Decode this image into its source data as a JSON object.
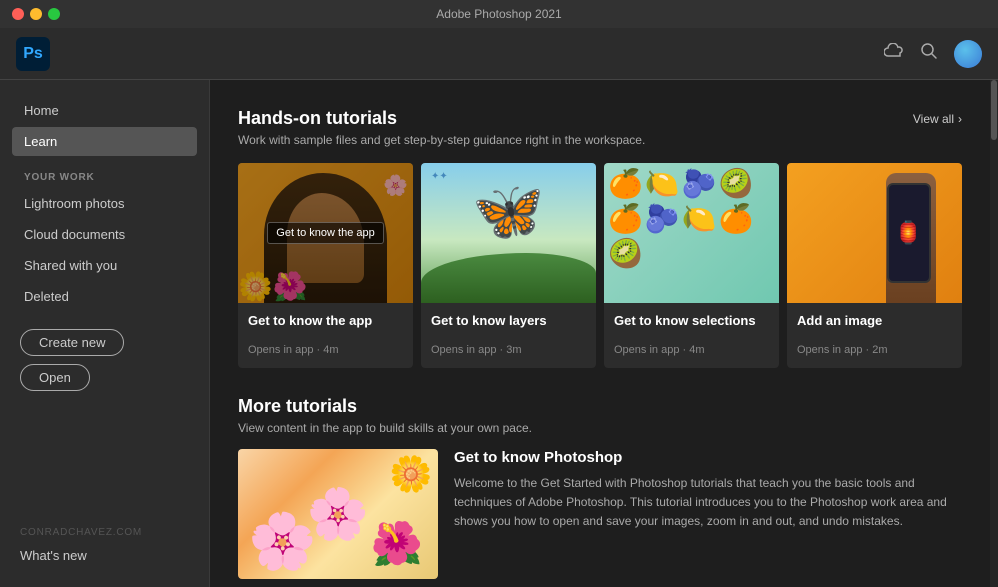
{
  "window": {
    "title": "Adobe Photoshop 2021"
  },
  "header": {
    "logo": "Ps",
    "cloud_icon": "☁",
    "search_icon": "🔍"
  },
  "sidebar": {
    "nav_items": [
      {
        "id": "home",
        "label": "Home",
        "active": false
      },
      {
        "id": "learn",
        "label": "Learn",
        "active": true
      }
    ],
    "your_work_label": "YOUR WORK",
    "your_work_items": [
      {
        "id": "lightroom",
        "label": "Lightroom photos"
      },
      {
        "id": "cloud",
        "label": "Cloud documents"
      },
      {
        "id": "shared",
        "label": "Shared with you"
      },
      {
        "id": "deleted",
        "label": "Deleted"
      }
    ],
    "create_new_label": "Create new",
    "open_label": "Open",
    "watermark": "CONRADCHAVEZ.COM",
    "whats_new": "What's new"
  },
  "main": {
    "tutorials": {
      "heading": "Hands-on tutorials",
      "subtitle": "Work with sample files and get step-by-step guidance right in the workspace.",
      "view_all": "View all",
      "cards": [
        {
          "id": "know-app",
          "title": "Get to know the app",
          "meta": "Opens in app · 4m",
          "has_overlay": true,
          "overlay_text": "Get to know the app",
          "image_type": "woman"
        },
        {
          "id": "know-layers",
          "title": "Get to know layers",
          "meta": "Opens in app · 3m",
          "has_overlay": false,
          "image_type": "butterfly"
        },
        {
          "id": "know-selections",
          "title": "Get to know selections",
          "meta": "Opens in app · 4m",
          "has_overlay": false,
          "image_type": "fruits"
        },
        {
          "id": "add-image",
          "title": "Add an image",
          "meta": "Opens in app · 2m",
          "has_overlay": false,
          "image_type": "phone"
        }
      ]
    },
    "more_tutorials": {
      "heading": "More tutorials",
      "subtitle": "View content in the app to build skills at your own pace.",
      "featured": {
        "title": "Get to know Photoshop",
        "description": "Welcome to the Get Started with Photoshop tutorials that teach you the basic tools and techniques of Adobe Photoshop. This tutorial introduces you to the Photoshop work area and shows you how to open and save your images, zoom in and out, and undo mistakes.",
        "image_type": "flowers"
      }
    }
  }
}
